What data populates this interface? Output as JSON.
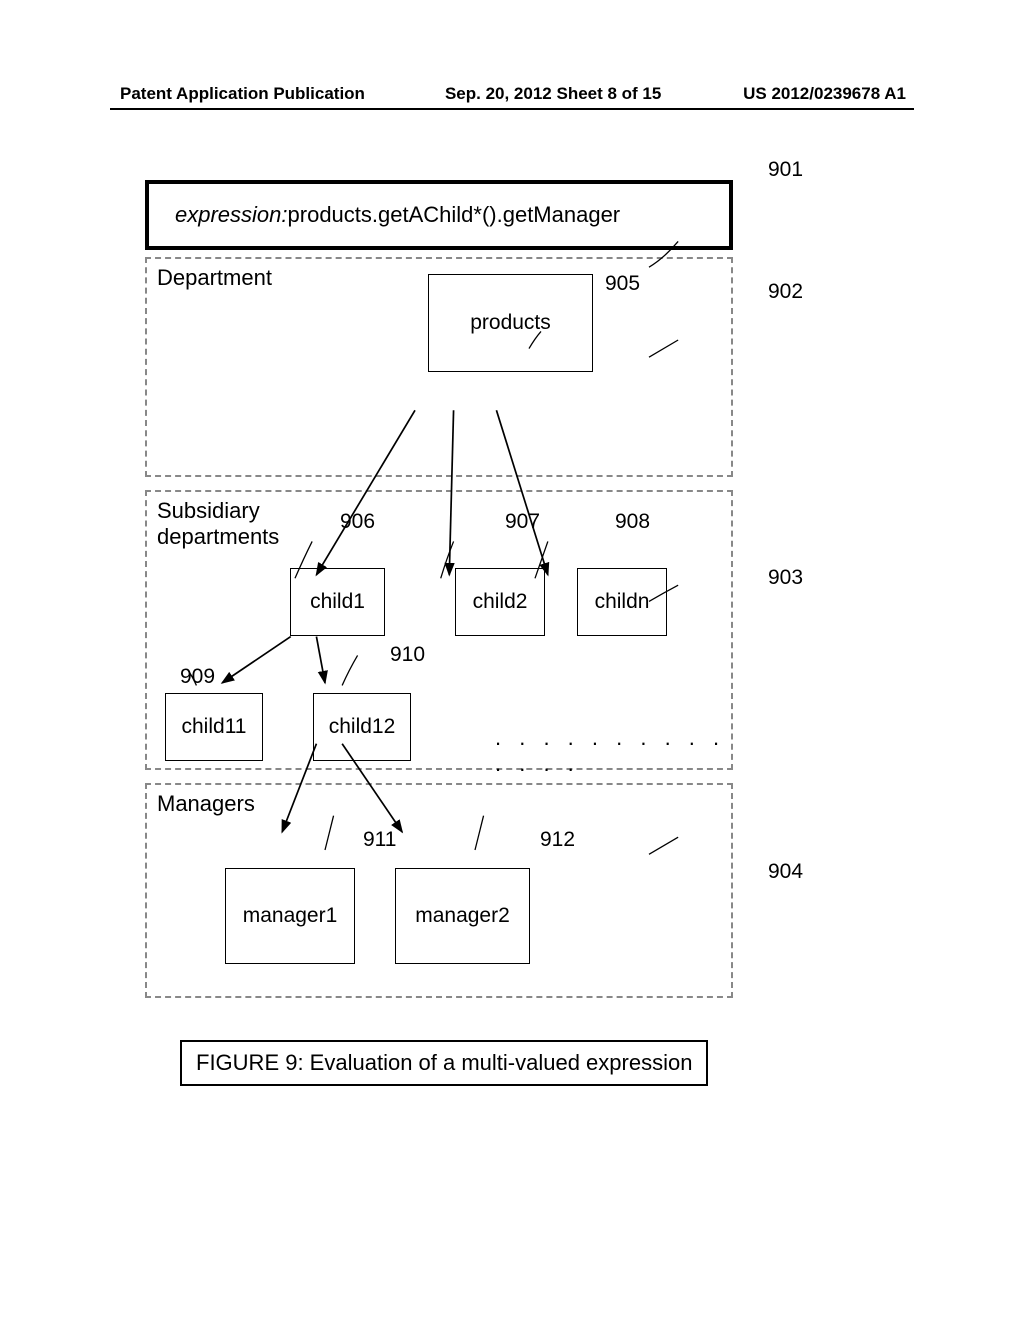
{
  "header": {
    "left": "Patent Application Publication",
    "center": "Sep. 20, 2012  Sheet 8 of 15",
    "right": "US 2012/0239678 A1"
  },
  "expression": {
    "label": "expression:",
    "value": " products.getAChild*().getManager"
  },
  "groups": {
    "department": "Department",
    "subsidiary": "Subsidiary departments",
    "managers": "Managers"
  },
  "nodes": {
    "products": "products",
    "child1": "child1",
    "child2": "child2",
    "childn": "childn",
    "child11": "child11",
    "child12": "child12",
    "manager1": "manager1",
    "manager2": "manager2"
  },
  "refs": {
    "r901": "901",
    "r902": "902",
    "r903": "903",
    "r904": "904",
    "r905": "905",
    "r906": "906",
    "r907": "907",
    "r908": "908",
    "r909": "909",
    "r910": "910",
    "r911": "911",
    "r912": "912"
  },
  "ellipsis": ". . . . . . . . . . . . . .",
  "caption": "FIGURE 9: Evaluation of a multi-valued expression"
}
